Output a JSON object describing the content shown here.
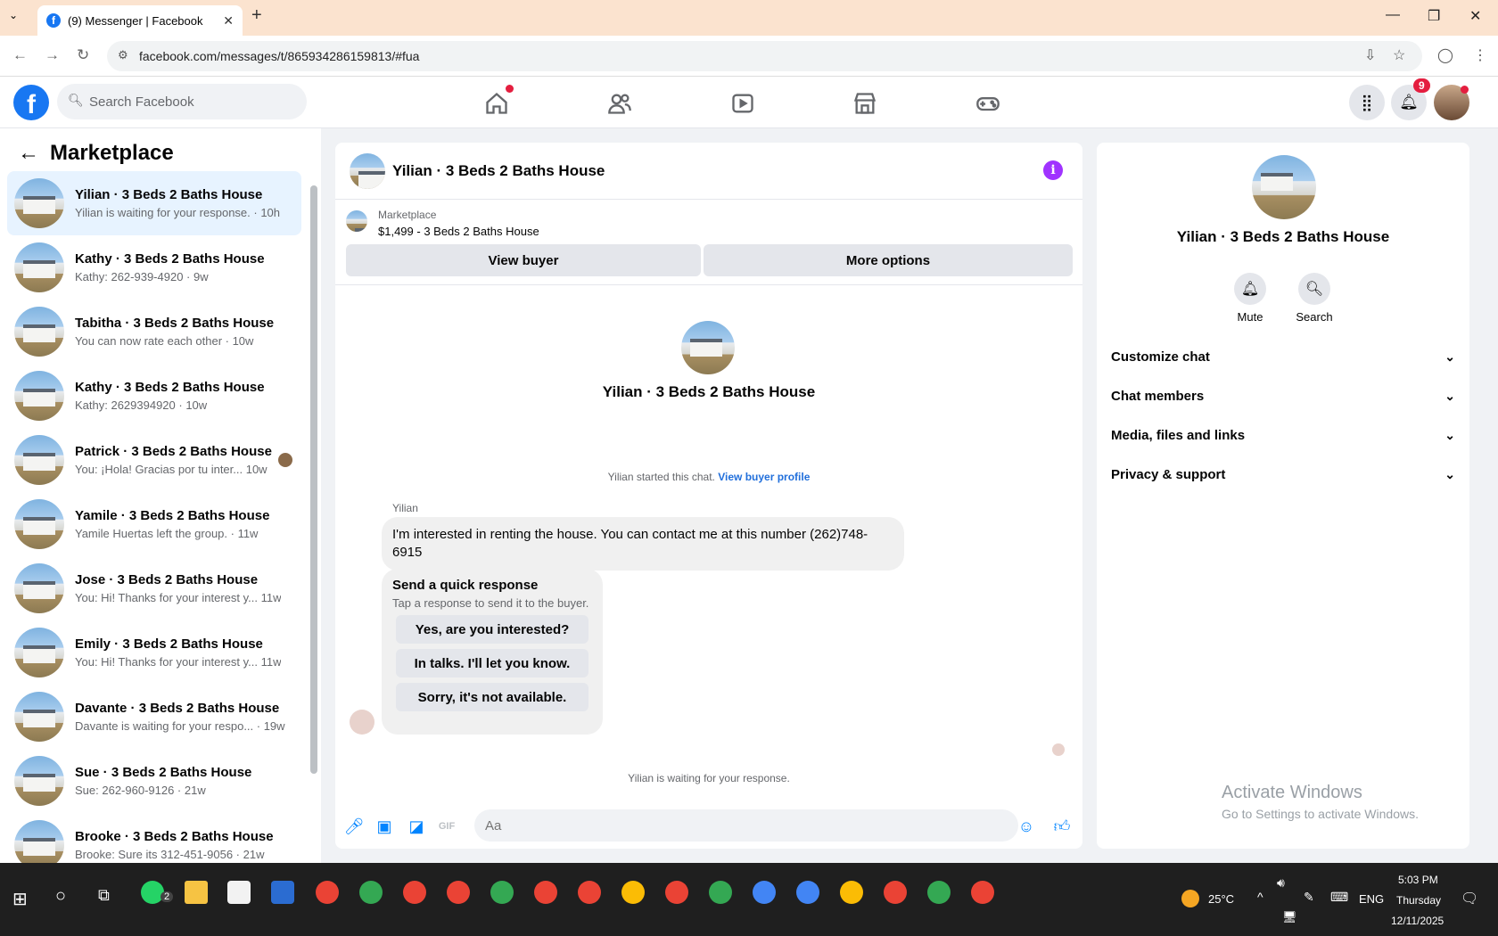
{
  "browser": {
    "tab_title": "(9) Messenger | Facebook",
    "url": "facebook.com/messages/t/865934286159813/#fua"
  },
  "header": {
    "search_placeholder": "Search Facebook",
    "notifications_count": "9"
  },
  "sidebar": {
    "title": "Marketplace",
    "conversations": [
      {
        "name": "Yilian · 3 Beds 2 Baths House",
        "preview": "Yilian is waiting for your response. · 10h"
      },
      {
        "name": "Kathy · 3 Beds 2 Baths House",
        "preview": "Kathy: 262-939-4920 · 9w"
      },
      {
        "name": "Tabitha · 3 Beds 2 Baths House",
        "preview": "You can now rate each other · 10w"
      },
      {
        "name": "Kathy · 3 Beds 2 Baths House",
        "preview": "Kathy: 2629394920 · 10w"
      },
      {
        "name": "Patrick · 3 Beds 2 Baths House",
        "preview": "You: ¡Hola! Gracias por tu inter...  10w"
      },
      {
        "name": "Yamile · 3 Beds 2 Baths House",
        "preview": "Yamile Huertas left the group. · 11w"
      },
      {
        "name": "Jose · 3 Beds 2 Baths House",
        "preview": "You: Hi! Thanks for your interest y...  11w"
      },
      {
        "name": "Emily · 3 Beds 2 Baths House",
        "preview": "You: Hi! Thanks for your interest y...  11w"
      },
      {
        "name": "Davante · 3 Beds 2 Baths House",
        "preview": "Davante is waiting for your respo... · 19w"
      },
      {
        "name": "Sue · 3 Beds 2 Baths House",
        "preview": "Sue: 262-960-9126 · 21w"
      },
      {
        "name": "Brooke · 3 Beds 2 Baths House",
        "preview": "Brooke: Sure its 312-451-9056 · 21w"
      }
    ]
  },
  "chat": {
    "title": "Yilian · 3 Beds 2 Baths House",
    "listing_source": "Marketplace",
    "listing_price": "$1,499 - 3 Beds 2 Baths House",
    "view_buyer": "View buyer",
    "more_options": "More options",
    "profile_name": "Yilian · 3 Beds 2 Baths House",
    "started_text": "Yilian started this chat.",
    "view_buyer_profile": "View buyer profile",
    "sender": "Yilian",
    "message": "I'm interested in renting the house. You can contact me at  this number (262)748-6915",
    "quick_title": "Send a quick response",
    "quick_sub": "Tap a response to send it to the buyer.",
    "quick_replies": [
      "Yes, are you interested?",
      "In talks. I'll let you know.",
      "Sorry, it's not available."
    ],
    "waiting": "Yilian is waiting for your response.",
    "input_placeholder": "Aa"
  },
  "details": {
    "name": "Yilian · 3 Beds 2 Baths House",
    "mute": "Mute",
    "search": "Search",
    "sections": [
      "Customize chat",
      "Chat members",
      "Media, files and links",
      "Privacy & support"
    ]
  },
  "watermark": {
    "line1": "Activate Windows",
    "line2": "Go to Settings to activate Windows."
  },
  "taskbar": {
    "whatsapp_badge": "2",
    "weather": "25°C",
    "lang": "ENG",
    "time": "5:03 PM",
    "day": "Thursday",
    "date": "12/11/2025"
  },
  "colors": {
    "brand": "#1877f2",
    "messenger_blue": "#0084ff",
    "active_row": "#e7f3ff",
    "info_purple": "#a033ff"
  }
}
